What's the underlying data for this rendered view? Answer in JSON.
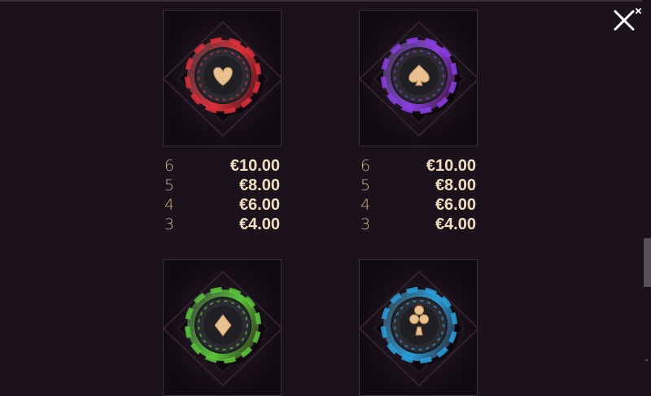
{
  "symbols": [
    {
      "suit": "heart-icon",
      "chip_color": "#d9303a",
      "paytable": [
        {
          "count": "6",
          "amount": "€10.00"
        },
        {
          "count": "5",
          "amount": "€8.00"
        },
        {
          "count": "4",
          "amount": "€6.00"
        },
        {
          "count": "3",
          "amount": "€4.00"
        }
      ]
    },
    {
      "suit": "spade-icon",
      "chip_color": "#8a3ee0",
      "paytable": [
        {
          "count": "6",
          "amount": "€10.00"
        },
        {
          "count": "5",
          "amount": "€8.00"
        },
        {
          "count": "4",
          "amount": "€6.00"
        },
        {
          "count": "3",
          "amount": "€4.00"
        }
      ]
    },
    {
      "suit": "diamond-icon",
      "chip_color": "#59c23a",
      "paytable": []
    },
    {
      "suit": "club-icon",
      "chip_color": "#2a9cd6",
      "paytable": []
    }
  ],
  "close_icon": "close-icon",
  "colors": {
    "background": "#1b121b",
    "count_text": "#c9b08a",
    "amount_text": "#f1ddc0",
    "suit_gold": "#e9c08f"
  }
}
